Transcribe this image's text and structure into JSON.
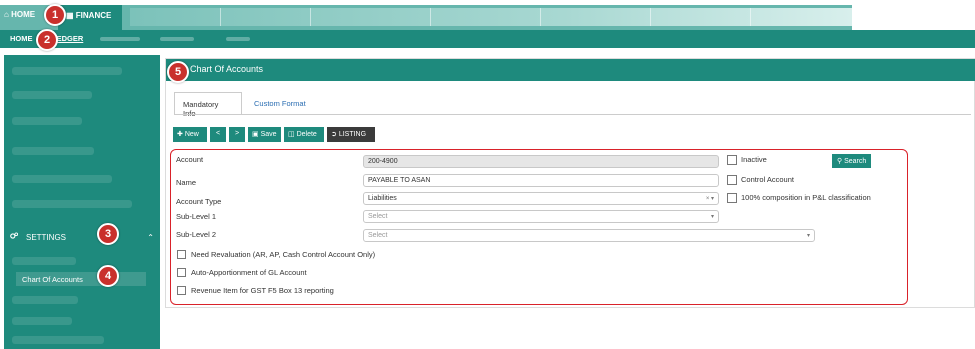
{
  "topbar": {
    "home_label": "HOME",
    "finance_label": "FINANCE"
  },
  "subnav": {
    "home_label": "HOME",
    "ledger_label": "LEDGER"
  },
  "sidebar": {
    "settings_label": "SETTINGS",
    "chart_of_accounts_label": "Chart Of Accounts"
  },
  "main": {
    "title": "Chart Of Accounts",
    "tabs": [
      {
        "label": "Mandatory Info"
      },
      {
        "label": "Custom Format"
      }
    ],
    "toolbar": {
      "new_label": "New",
      "prev_label": "<",
      "next_label": ">",
      "save_label": "Save",
      "delete_label": "Delete",
      "listing_label": "LISTING"
    },
    "form": {
      "account_label": "Account",
      "account_value": "200-4900",
      "name_label": "Name",
      "name_value": "PAYABLE TO ASAN",
      "account_type_label": "Account Type",
      "account_type_value": "Liabilities",
      "sublevel1_label": "Sub-Level 1",
      "sublevel1_placeholder": "Select",
      "sublevel2_label": "Sub-Level 2",
      "sublevel2_placeholder": "Select",
      "inactive_label": "Inactive",
      "control_account_label": "Control Account",
      "composition_label": "100% composition in P&L classification",
      "search_label": "Search",
      "revaluation_label": "Need Revaluation (AR, AP, Cash Control Account Only)",
      "auto_apportion_label": "Auto-Apportionment of GL Account",
      "revenue_item_label": "Revenue Item for GST F5 Box 13 reporting"
    }
  },
  "badges": [
    "1",
    "2",
    "3",
    "4",
    "5"
  ],
  "colors": {
    "primary": "#1e8a7d",
    "highlight_border": "#d9222a",
    "badge": "#c9302c"
  }
}
